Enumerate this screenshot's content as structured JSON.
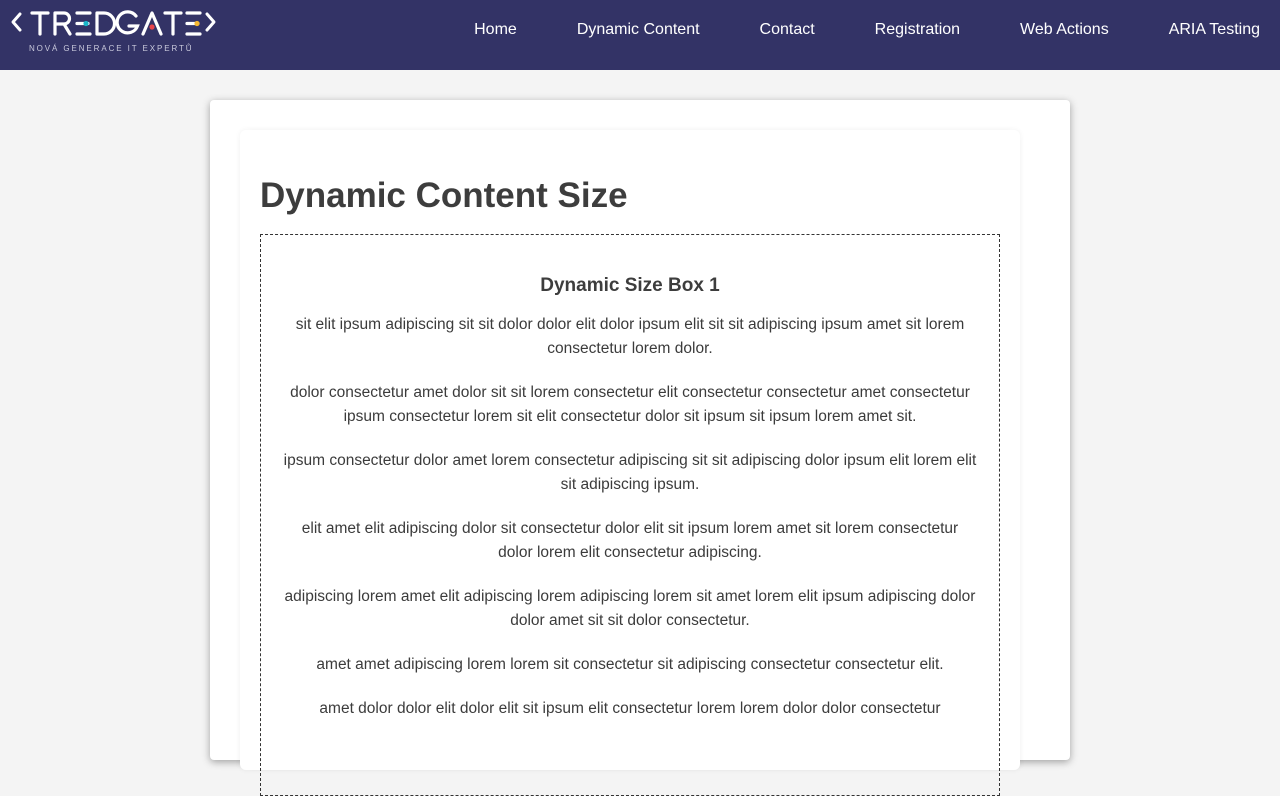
{
  "header": {
    "logo_text": "TREDGATE",
    "logo_tagline": "NOVÁ GENERACE IT EXPERTŮ",
    "nav": [
      {
        "label": "Home"
      },
      {
        "label": "Dynamic Content"
      },
      {
        "label": "Contact"
      },
      {
        "label": "Registration"
      },
      {
        "label": "Web Actions"
      },
      {
        "label": "ARIA Testing"
      }
    ]
  },
  "main": {
    "title": "Dynamic Content Size",
    "box": {
      "title": "Dynamic Size Box 1",
      "paragraphs": [
        "sit elit ipsum adipiscing sit sit dolor dolor elit dolor ipsum elit sit sit adipiscing ipsum amet sit lorem consectetur lorem dolor.",
        "dolor consectetur amet dolor sit sit lorem consectetur elit consectetur consectetur amet consectetur ipsum consectetur lorem sit elit consectetur dolor sit ipsum sit ipsum lorem amet sit.",
        "ipsum consectetur dolor amet lorem consectetur adipiscing sit sit adipiscing dolor ipsum elit lorem elit sit adipiscing ipsum.",
        "elit amet elit adipiscing dolor sit consectetur dolor elit sit ipsum lorem amet sit lorem consectetur dolor lorem elit consectetur adipiscing.",
        "adipiscing lorem amet elit adipiscing lorem adipiscing lorem sit amet lorem elit ipsum adipiscing dolor dolor amet sit sit dolor consectetur.",
        "amet amet adipiscing lorem lorem sit consectetur sit adipiscing consectetur consectetur elit.",
        "amet dolor dolor elit dolor elit sit ipsum elit consectetur lorem lorem dolor dolor consectetur"
      ]
    }
  },
  "colors": {
    "header_bg": "#333366",
    "page_bg": "#f4f4f4",
    "logo_dot_teal": "#19b5c8",
    "logo_dot_red": "#e8434b",
    "logo_dot_yellow": "#f5b731"
  }
}
